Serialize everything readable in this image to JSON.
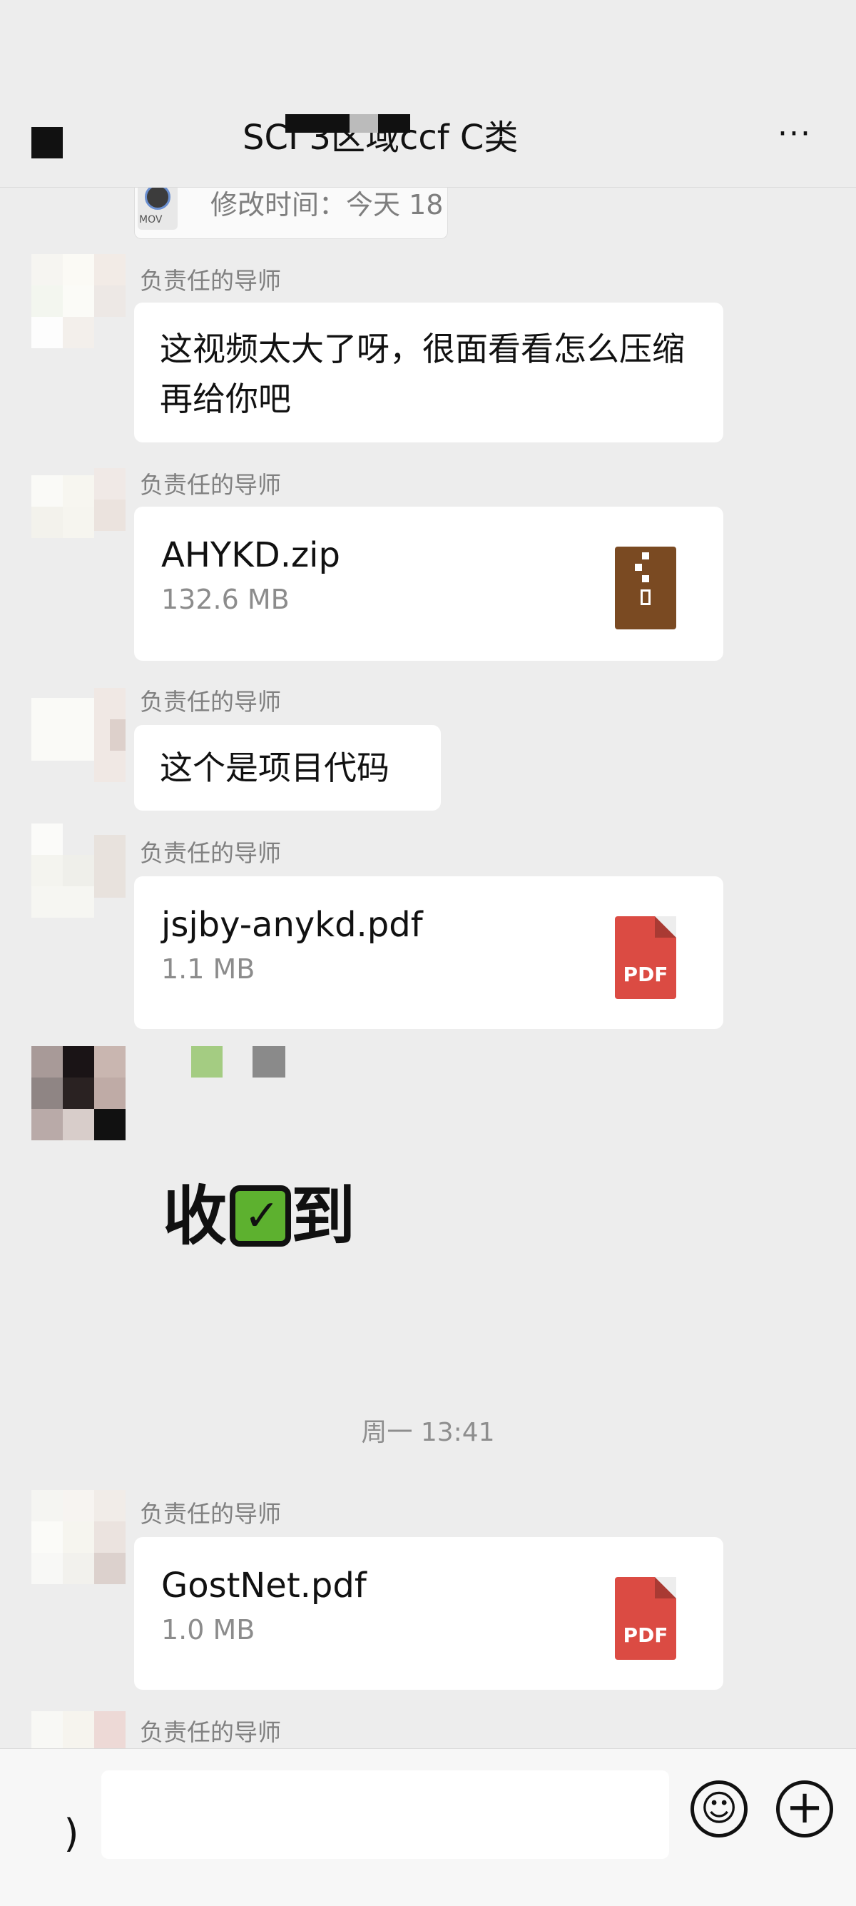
{
  "header": {
    "title": "SCI 3区域ccf C类",
    "more": "···"
  },
  "file_preview": {
    "file_type_label": "MOV",
    "modified": "修改时间：今天 18"
  },
  "messages": [
    {
      "sender": "负责任的导师",
      "text": "这视频太大了呀，很面看看怎么压缩再给你吧"
    },
    {
      "sender": "负责任的导师",
      "file_name": "AHYKD.zip",
      "file_size": "132.6 MB"
    },
    {
      "sender": "负责任的导师",
      "text": "这个是项目代码"
    },
    {
      "sender": "负责任的导师",
      "file_name": "jsjby-anykd.pdf",
      "file_size": "1.1 MB",
      "icon_label": "PDF"
    },
    {
      "sticker": {
        "before": "收",
        "after": "到",
        "check": "✓"
      }
    },
    {
      "sender": "负责任的导师",
      "file_name": "GostNet.pdf",
      "file_size": "1.0 MB",
      "icon_label": "PDF"
    },
    {
      "sender": "负责任的导师"
    }
  ],
  "timestamp": "周一 13:41",
  "input_bar": {
    "emoji_icon": "☺",
    "plus_icon": "+"
  },
  "colors": {
    "background": "#ededed",
    "bubble": "#ffffff",
    "zip_icon": "#7a4a22",
    "pdf_icon": "#db4b43",
    "sticker_check": "#5db12f"
  }
}
